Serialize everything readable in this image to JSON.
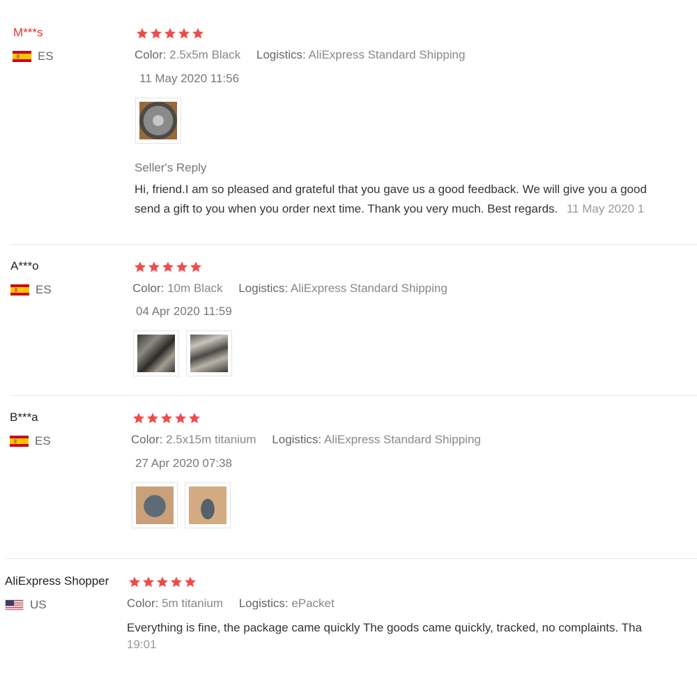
{
  "theme": {
    "star_color": "#ef4b4b",
    "name_red": "#e62e2e"
  },
  "labels": {
    "color": "Color:",
    "logistics": "Logistics:",
    "seller_reply": "Seller's Reply"
  },
  "reviews": [
    {
      "user": "M***s",
      "country": "ES",
      "stars": 5,
      "color": "2.5x5m Black",
      "logistics": "AliExpress Standard Shipping",
      "date": "11 May 2020 11:56",
      "photos": 1,
      "seller_reply": {
        "line1": "Hi, friend.I am so pleased and grateful that you gave us a good feedback. We will give you a good",
        "line2": "send a gift to you when you order next time. Thank you very much. Best regards.",
        "date": "11 May 2020 1"
      }
    },
    {
      "user": "A***o",
      "country": "ES",
      "stars": 5,
      "color": "10m Black",
      "logistics": "AliExpress Standard Shipping",
      "date": "04 Apr 2020 11:59",
      "photos": 2
    },
    {
      "user": "B***a",
      "country": "ES",
      "stars": 5,
      "color": "2.5x15m titanium",
      "logistics": "AliExpress Standard Shipping",
      "date": "27 Apr 2020 07:38",
      "photos": 2
    },
    {
      "user": "AliExpress Shopper",
      "country": "US",
      "stars": 5,
      "color": "5m titanium",
      "logistics": "ePacket",
      "text_line1": "Everything is fine, the package came quickly The goods came quickly, tracked, no complaints. Tha",
      "text_line2": "19:01"
    }
  ]
}
